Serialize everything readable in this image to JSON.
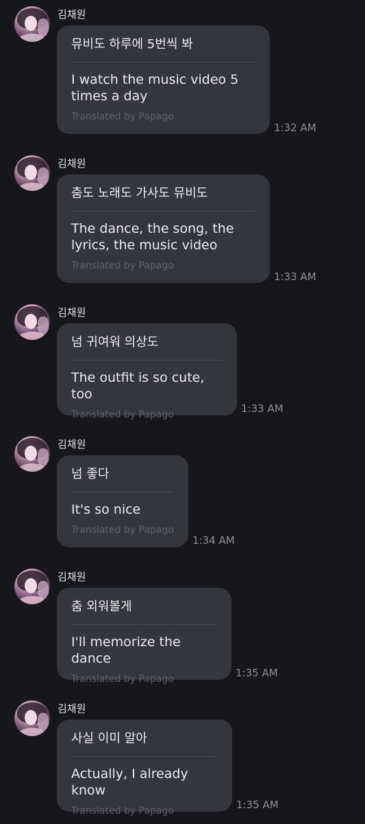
{
  "messages": [
    {
      "sender": "김채원",
      "original": "뮤비도 하루에 5번씩 봐",
      "translation": "I watch the music video 5 times a day",
      "credit": "Translated by Papago",
      "time": "1:32 AM"
    },
    {
      "sender": "김채원",
      "original": "춤도 노래도 가사도 뮤비도",
      "translation": "The dance, the song, the lyrics, the music video",
      "credit": "Translated by Papago",
      "time": "1:33 AM"
    },
    {
      "sender": "김채원",
      "original": "넘 귀여워 의상도",
      "translation": "The outfit is so cute, too",
      "credit": "Translated by Papago",
      "time": "1:33 AM"
    },
    {
      "sender": "김채원",
      "original": "넘 좋다",
      "translation": "It's so nice",
      "credit": "Translated by Papago",
      "time": "1:34 AM"
    },
    {
      "sender": "김채원",
      "original": "춤 외워볼게",
      "translation": "I'll memorize the dance",
      "credit": "Translated by Papago",
      "time": "1:35 AM"
    },
    {
      "sender": "김채원",
      "original": "사실 이미 알아",
      "translation": "Actually, I already know",
      "credit": "Translated by Papago",
      "time": "1:35 AM"
    }
  ]
}
